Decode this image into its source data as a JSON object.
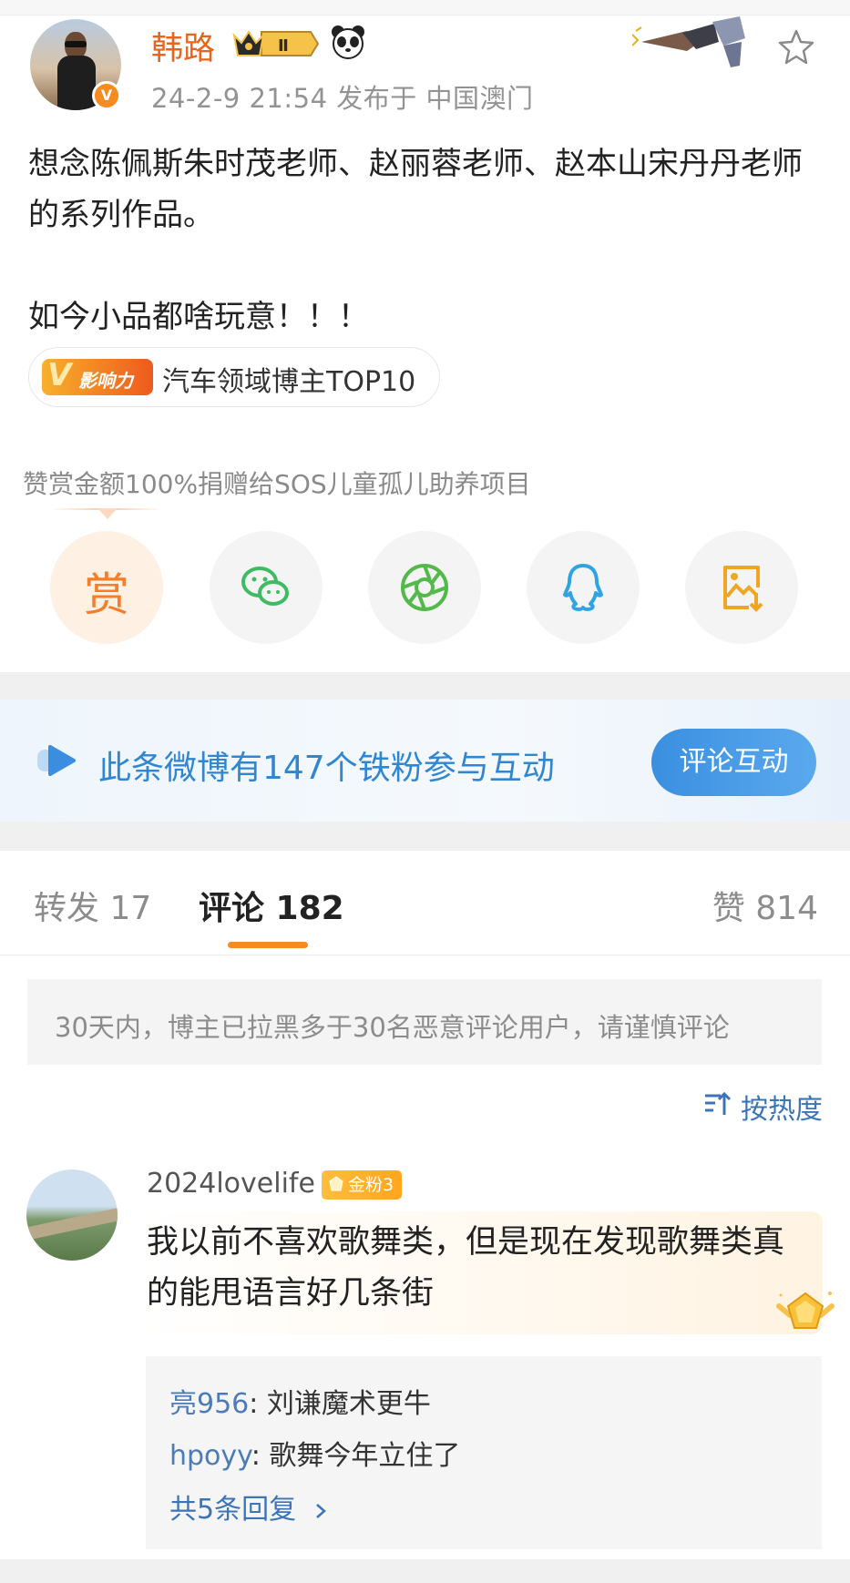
{
  "post": {
    "username": "韩路",
    "level_badge": "Ⅱ",
    "meta": "24-2-9 21:54   发布于 中国澳门",
    "text": "想念陈佩斯朱时茂老师、赵丽蓉老师、赵本山宋丹丹老师的系列作品。\n\n如今小品都啥玩意！！！",
    "influence_badge": "影响力",
    "influence_label": "汽车领域博主TOP10"
  },
  "reward": {
    "note": "赞赏金额100%捐赠给SOS儿童孤儿助养项目",
    "reward_label": "赏",
    "share_icons": [
      "wechat-icon",
      "moments-icon",
      "qq-icon",
      "save-image-icon"
    ]
  },
  "fans_banner": {
    "text": "此条微博有147个铁粉参与互动",
    "button": "评论互动"
  },
  "tabs": {
    "repost": "转发 17",
    "comment": "评论 182",
    "like": "赞 814"
  },
  "warning": "30天内，博主已拉黑多于30名恶意评论用户，请谨慎评论",
  "sort_label": "按热度",
  "comment": {
    "username": "2024lovelife",
    "fan_badge": "金粉3",
    "text": "我以前不喜欢歌舞类，但是现在发现歌舞类真的能甩语言好几条街",
    "replies": [
      {
        "user": "亮956",
        "text": ": 刘谦魔术更牛"
      },
      {
        "user": "hpoyy",
        "text": ": 歌舞今年立住了"
      }
    ],
    "more_replies": "共5条回复"
  },
  "colors": {
    "brand_orange": "#e8641b",
    "link_blue": "#3c74b8",
    "banner_blue": "#2f86d3"
  }
}
